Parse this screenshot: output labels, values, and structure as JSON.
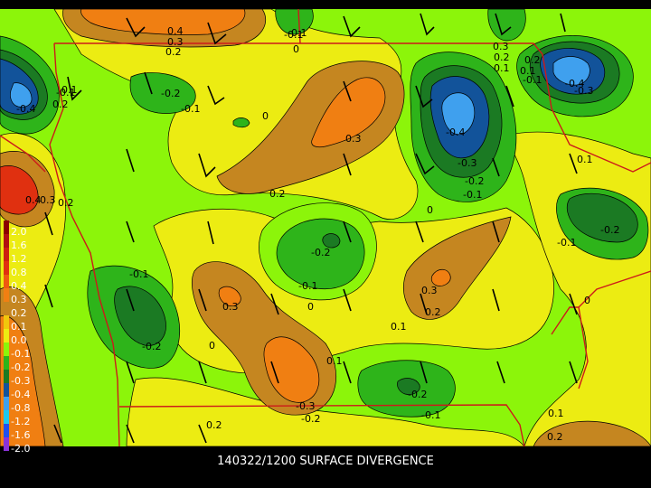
{
  "caption": "140322/1200 SURFACE DIVERGENCE",
  "legend": {
    "levels": [
      {
        "label": "2.0",
        "color": "#8b0000"
      },
      {
        "label": "1.6",
        "color": "#b01010"
      },
      {
        "label": "1.2",
        "color": "#cc2010"
      },
      {
        "label": "0.8",
        "color": "#e03010"
      },
      {
        "label": "0.4",
        "color": "#ee5a10"
      },
      {
        "label": "0.3",
        "color": "#f07f12"
      },
      {
        "label": "0.2",
        "color": "#c58620"
      },
      {
        "label": "0.1",
        "color": "#f1c60c"
      },
      {
        "label": "0.0",
        "color": "#ecec12"
      },
      {
        "label": "-0.1",
        "color": "#8cf50a"
      },
      {
        "label": "-0.2",
        "color": "#2eb41a"
      },
      {
        "label": "-0.3",
        "color": "#1b7a23"
      },
      {
        "label": "-0.4",
        "color": "#12539a"
      },
      {
        "label": "-0.8",
        "color": "#3fa0ee"
      },
      {
        "label": "-1.2",
        "color": "#1dc8ee"
      },
      {
        "label": "-1.6",
        "color": "#2050ee"
      },
      {
        "label": "-2.0",
        "color": "#8a32d8"
      }
    ]
  },
  "contour_labels": [
    "0.4",
    "0.3",
    "0.2",
    "-0.1",
    "0",
    "0.3",
    "0.2",
    "0.1",
    "0.2",
    "0.1",
    "-0.4",
    "-0.3",
    "-0.1",
    "-0.4",
    "0.2",
    "-0.2",
    "-0.1",
    "0.3",
    "0",
    "-0.1",
    "0.1",
    "-0.4",
    "-0.3",
    "-0.2",
    "-0.1",
    "0.2",
    "0.4",
    "0.3",
    "0.2",
    "-0.1",
    "0.1",
    "0",
    "-0.1",
    "-0.2",
    "-0.2",
    "-0.1",
    "-0.1",
    "0",
    "0.3",
    "0.3",
    "0.2",
    "0.1",
    "0",
    "-0.2",
    "0.1",
    "-0.3",
    "-0.2",
    "-0.2",
    "-0.1",
    "0.2",
    "0.1",
    "0.2",
    "0"
  ],
  "colors": {
    "background": "#000000",
    "base_field": "#8cf50a",
    "borders": "#cc1a1a",
    "wind_barbs": "#000000"
  }
}
